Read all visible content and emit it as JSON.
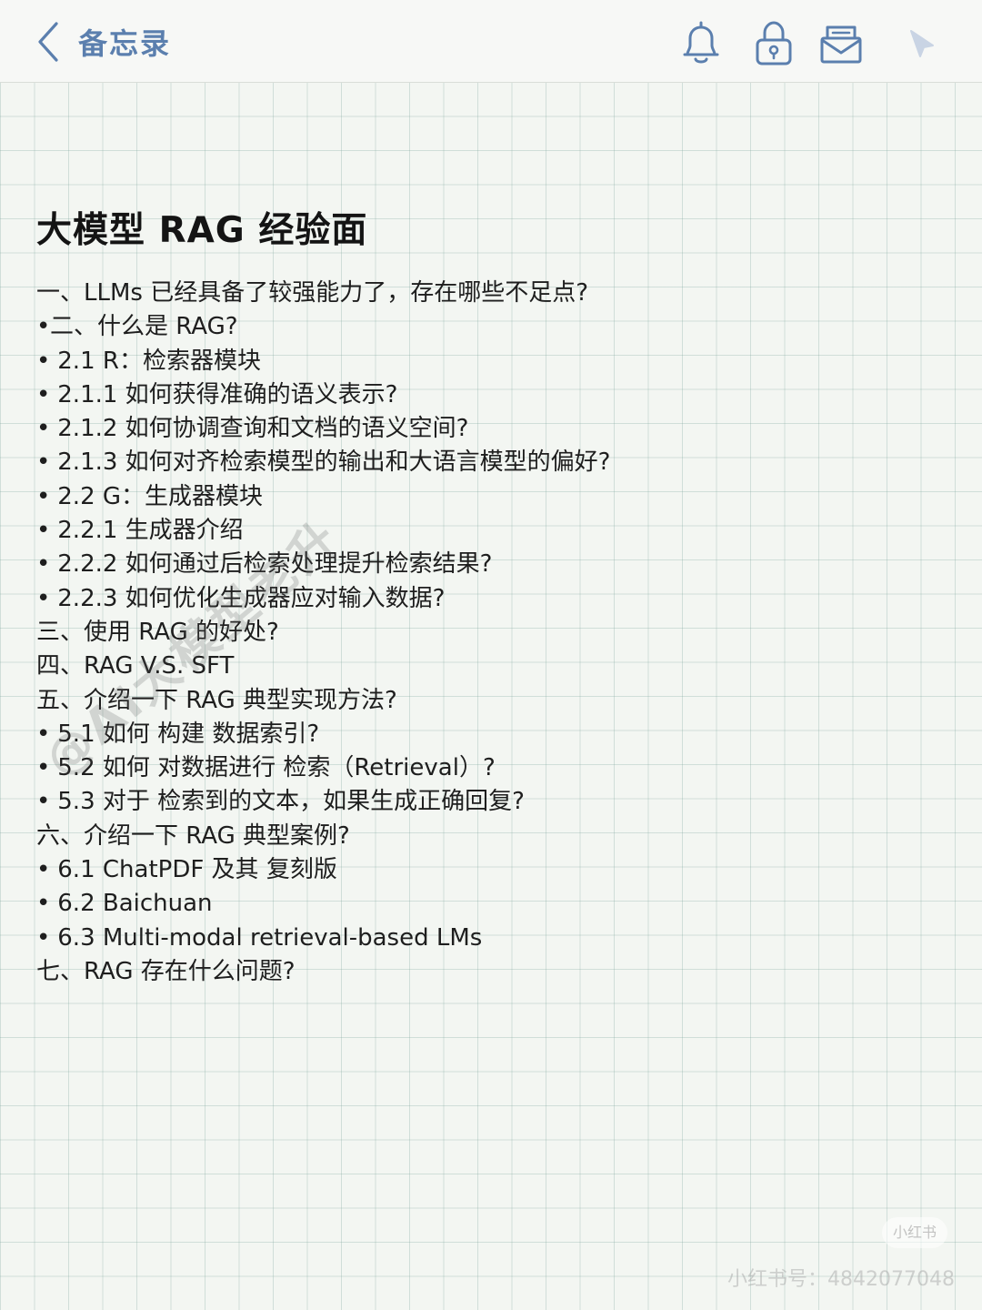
{
  "header": {
    "back_label": "备忘录"
  },
  "toolbar": {
    "icons": [
      "bell-icon",
      "lock-icon",
      "mail-icon",
      "cursor-icon"
    ]
  },
  "note": {
    "title": "大模型 RAG 经验面",
    "items": [
      {
        "bullet": "",
        "text": "一、LLMs 已经具备了较强能力了，存在哪些不足点?"
      },
      {
        "bullet": "•",
        "text": "二、什么是 RAG?"
      },
      {
        "bullet": "•",
        "text": " 2.1 R：检索器模块"
      },
      {
        "bullet": "•",
        "text": " 2.1.1 如何获得准确的语义表示?"
      },
      {
        "bullet": "•",
        "text": " 2.1.2 如何协调查询和文档的语义空间?"
      },
      {
        "bullet": "•",
        "text": " 2.1.3 如何对齐检索模型的输出和大语言模型的偏好?"
      },
      {
        "bullet": "•",
        "text": " 2.2 G：生成器模块"
      },
      {
        "bullet": "•",
        "text": " 2.2.1 生成器介绍"
      },
      {
        "bullet": "•",
        "text": " 2.2.2 如何通过后检索处理提升检索结果?"
      },
      {
        "bullet": "•",
        "text": " 2.2.3 如何优化生成器应对输入数据?"
      },
      {
        "bullet": "",
        "text": "三、使用 RAG 的好处?"
      },
      {
        "bullet": "",
        "text": "四、RAG V.S. SFT"
      },
      {
        "bullet": "",
        "text": "五、介绍一下 RAG 典型实现方法?"
      },
      {
        "bullet": "•",
        "text": " 5.1 如何 构建 数据索引?"
      },
      {
        "bullet": "•",
        "text": " 5.2 如何 对数据进行 检索（Retrieval）?"
      },
      {
        "bullet": "•",
        "text": " 5.3 对于 检索到的文本，如果生成正确回复?"
      },
      {
        "bullet": "",
        "text": "六、介绍一下 RAG 典型案例?"
      },
      {
        "bullet": "•",
        "text": " 6.1 ChatPDF 及其 复刻版"
      },
      {
        "bullet": "•",
        "text": " 6.2 Baichuan"
      },
      {
        "bullet": "•",
        "text": " 6.3 Multi-modal retrieval-based LMs"
      },
      {
        "bullet": "",
        "text": "七、RAG 存在什么问题?"
      }
    ]
  },
  "watermarks": {
    "diagonal": "@AI大模型老升",
    "badge": "小红书",
    "id_text": "小红书号：4842077048"
  }
}
